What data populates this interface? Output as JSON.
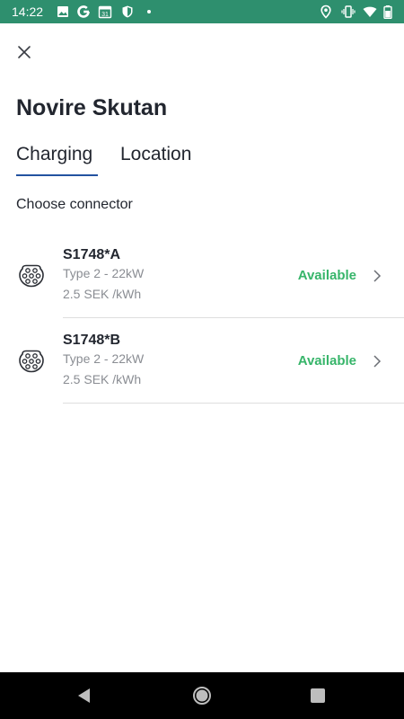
{
  "status_bar": {
    "time": "14:22",
    "left_icons": [
      "image-icon",
      "google-icon",
      "calendar-icon",
      "shield-icon"
    ],
    "calendar_day": "31",
    "right_icons": [
      "location-icon",
      "vibrate-icon",
      "wifi-icon",
      "battery-icon"
    ],
    "background_color": "#2e8f6e"
  },
  "header": {
    "close_icon": "close-icon",
    "title": "Novire Skutan"
  },
  "tabs": [
    {
      "label": "Charging",
      "active": true
    },
    {
      "label": "Location",
      "active": false
    }
  ],
  "section_label": "Choose connector",
  "connectors": [
    {
      "id": "S1748*A",
      "type": "Type 2 - 22kW",
      "price": "2.5 SEK /kWh",
      "status": "Available"
    },
    {
      "id": "S1748*B",
      "type": "Type 2 - 22kW",
      "price": "2.5 SEK /kWh",
      "status": "Available"
    }
  ],
  "colors": {
    "accent_tab": "#2352a0",
    "available": "#37b56a",
    "secondary_text": "#8a8d93"
  },
  "nav_bar": {
    "buttons": [
      "back-icon",
      "home-icon",
      "recents-icon"
    ]
  }
}
